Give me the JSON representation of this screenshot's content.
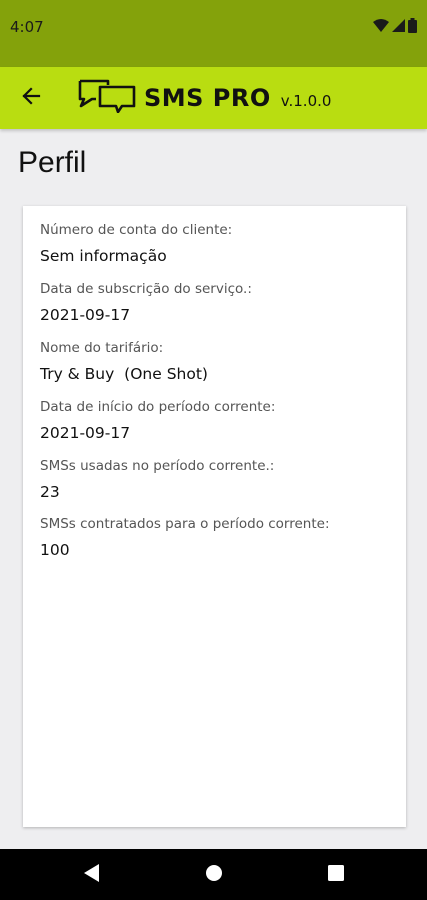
{
  "status_bar": {
    "time": "4:07",
    "icons": [
      "wifi-icon",
      "signal-icon",
      "battery-icon"
    ]
  },
  "app_bar": {
    "back_icon": "arrow-back-icon",
    "logo_icon": "sms-chat-icon",
    "app_name": "SMS PRO",
    "version": "v.1.0.0"
  },
  "page": {
    "title": "Perfil"
  },
  "profile": {
    "fields": [
      {
        "label": "Número de conta do cliente:",
        "value": "Sem informação"
      },
      {
        "label": "Data de subscrição do serviço.:",
        "value": "2021-09-17"
      },
      {
        "label": "Nome do tarifário:",
        "value": "Try & Buy  (One Shot)"
      },
      {
        "label": "Data de início do período corrente:",
        "value": "2021-09-17"
      },
      {
        "label": "SMSs usadas no período corrente.:",
        "value": "23"
      },
      {
        "label": "SMSs contratados para o período corrente:",
        "value": "100"
      }
    ]
  },
  "nav_bar": {
    "buttons": [
      "back-triangle-icon",
      "home-circle-icon",
      "recents-square-icon"
    ]
  },
  "colors": {
    "status_bar": "#84a20b",
    "app_bar": "#b9dd11",
    "background": "#eeeef0",
    "card": "#ffffff"
  }
}
